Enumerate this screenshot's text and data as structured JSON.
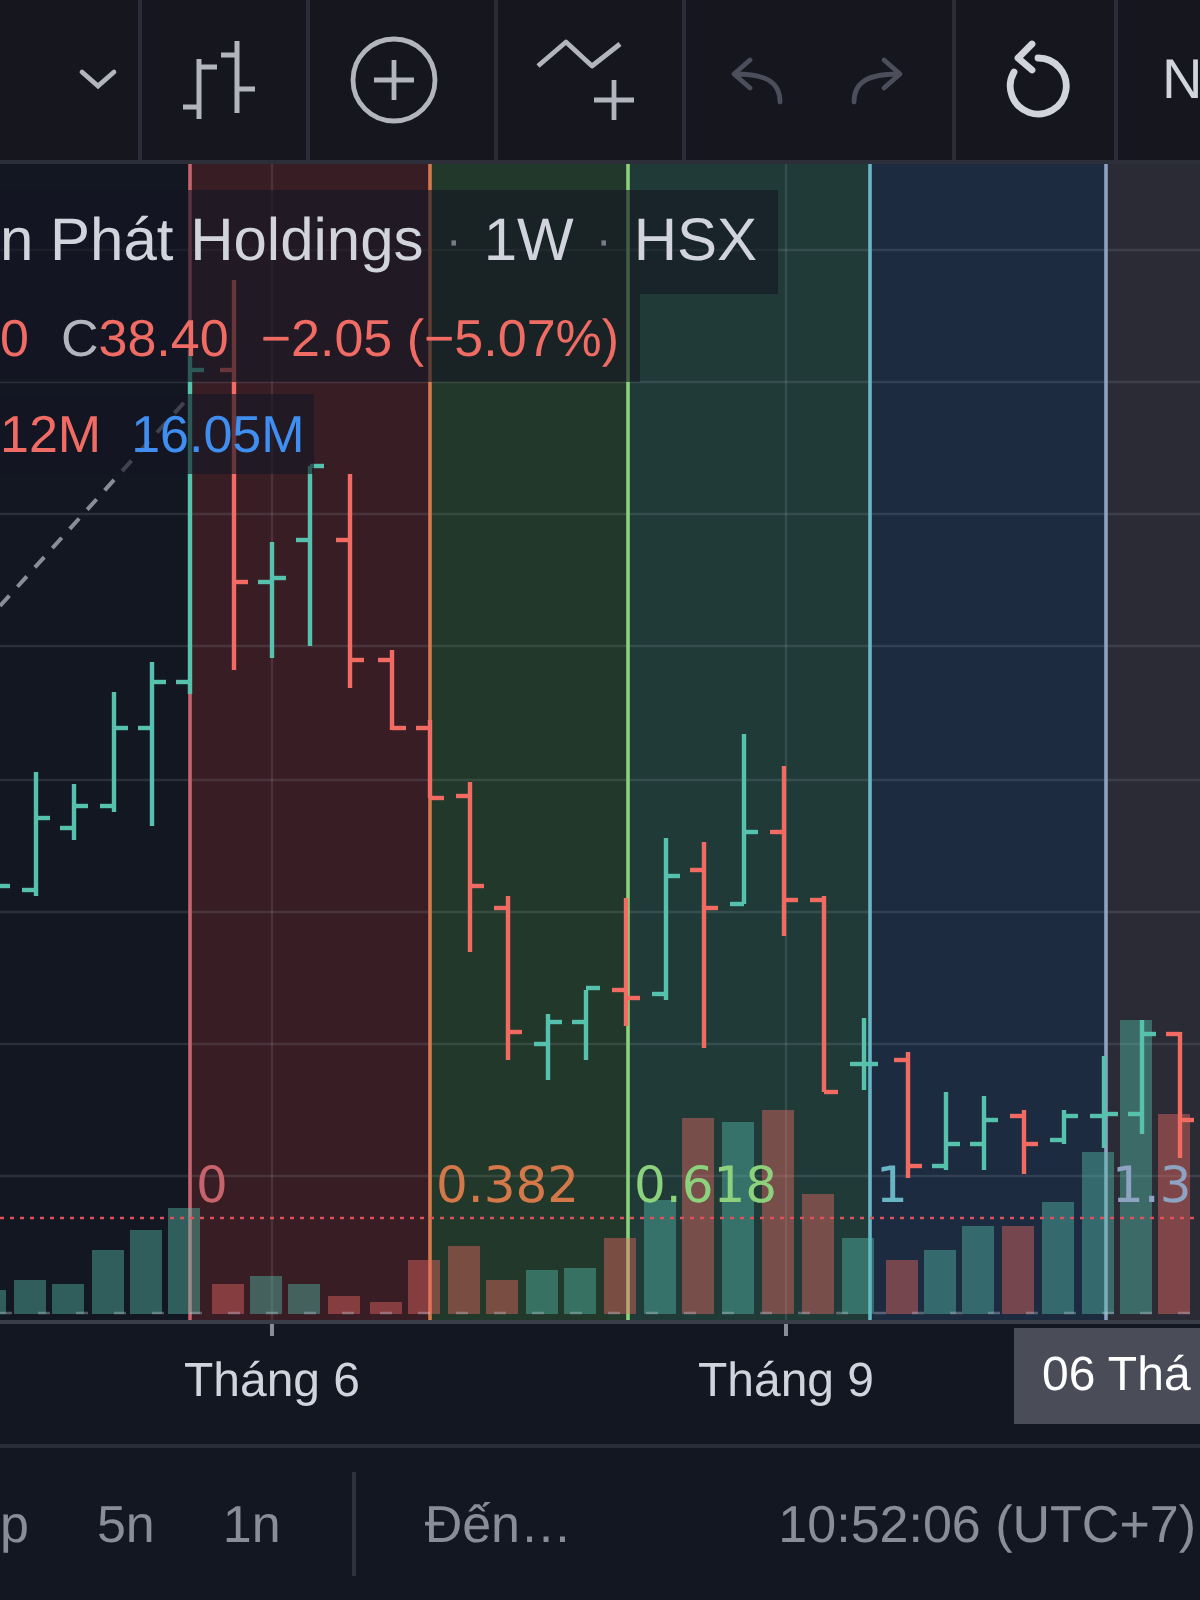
{
  "toolbar": {
    "undo": {
      "disabled": true
    },
    "redo": {
      "disabled": true
    },
    "cut_button": {
      "label": "N"
    }
  },
  "legend": {
    "title_row": [
      {
        "kind": "text",
        "text": "n Phát Holdings"
      },
      {
        "kind": "separator",
        "text": "·"
      },
      {
        "kind": "text",
        "text": "1W"
      },
      {
        "kind": "separator",
        "text": "·"
      },
      {
        "kind": "text",
        "text": "HSX"
      }
    ],
    "ohlc_row": [
      {
        "value": "0",
        "color": "#ef6b64"
      },
      {
        "label": "C",
        "value": "38.40",
        "color": "#ef6b64"
      },
      {
        "value": "−2.05 (−5.07%)",
        "color": "#ef6b64"
      }
    ],
    "volume_row": [
      {
        "value": "12M",
        "color": "#ef6b64"
      },
      {
        "value": "16.05M",
        "color": "#3f8ef0"
      }
    ]
  },
  "chart": {
    "time_zones": [
      {
        "label": "0",
        "color": "#c8636c"
      },
      {
        "label": "0.382",
        "color": "#d4784a"
      },
      {
        "label": "0.618",
        "color": "#8cd17c"
      },
      {
        "label": "1",
        "color": "#68b6c4"
      },
      {
        "label": "1.3",
        "color": "#8ea2c2"
      }
    ]
  },
  "time_axis": {
    "labels": [
      "Tháng 6",
      "Tháng 9"
    ],
    "crosshair_label": "06 Thá"
  },
  "bottom_bar": {
    "ranges": [
      "p",
      "5n",
      "1n"
    ],
    "go_to": "Đến…",
    "clock": "10:52:06 (UTC+7)"
  }
}
